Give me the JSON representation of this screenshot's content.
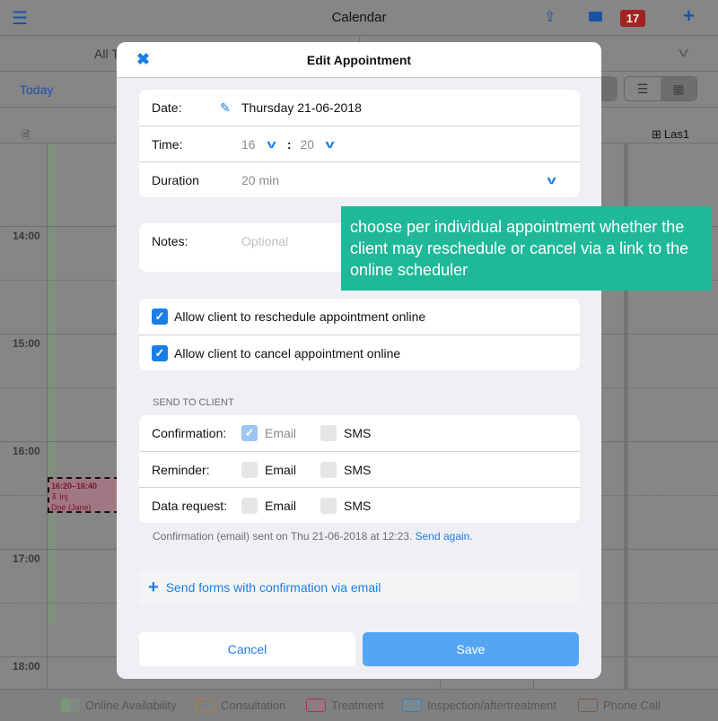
{
  "topbar": {
    "title": "Calendar",
    "badge": "17",
    "icons": [
      "menu-icon",
      "share-icon",
      "monitor-icon",
      "plus-icon"
    ]
  },
  "filter": {
    "left": "All T",
    "chevron": "chevron-down-icon"
  },
  "toolbar": {
    "today": "Today"
  },
  "column": {
    "resource": "Las1"
  },
  "hours": [
    "14:00",
    "15:00",
    "16:00",
    "17:00",
    "18:00"
  ],
  "appointment": {
    "time": "16:20–16:40",
    "type": "Inj",
    "client": "Doe (Jane)"
  },
  "legend": [
    "Online Availability",
    "Consultation",
    "Treatment",
    "Inspection/aftertreatment",
    "Phone Call"
  ],
  "legend_colors": [
    "#6a9a6a",
    "#c07a30",
    "#b03050",
    "#3a7fb0",
    "#7a5a40"
  ],
  "modal": {
    "title": "Edit Appointment",
    "date_label": "Date:",
    "date_value": "Thursday 21-06-2018",
    "time_label": "Time:",
    "hour": "16",
    "minute": "20",
    "sep": ":",
    "duration_label": "Duration",
    "duration_value": "20 min",
    "notes_label": "Notes:",
    "notes_placeholder": "Optional",
    "allow_reschedule": "Allow client to reschedule appointment online",
    "allow_reschedule_checked": true,
    "allow_cancel": "Allow client to cancel appointment online",
    "allow_cancel_checked": true,
    "send_header": "SEND TO CLIENT",
    "send_rows": [
      {
        "label": "Confirmation:",
        "email": "Email",
        "sms": "SMS",
        "email_checked": true,
        "sms_checked": false
      },
      {
        "label": "Reminder:",
        "email": "Email",
        "sms": "SMS",
        "email_checked": false,
        "sms_checked": false
      },
      {
        "label": "Data request:",
        "email": "Email",
        "sms": "SMS",
        "email_checked": false,
        "sms_checked": false
      }
    ],
    "sent_note": "Confirmation (email) sent on Thu 21-06-2018 at 12:23.",
    "send_again": "Send again.",
    "send_forms": "Send forms with confirmation via email",
    "cancel": "Cancel",
    "save": "Save"
  },
  "tooltip": "choose per individual appointment whether the client may reschedule or cancel via a link to the online scheduler",
  "colors": {
    "accent": "#1a7ee8",
    "tooltip": "#1fb99a",
    "save": "#54a6f5"
  }
}
